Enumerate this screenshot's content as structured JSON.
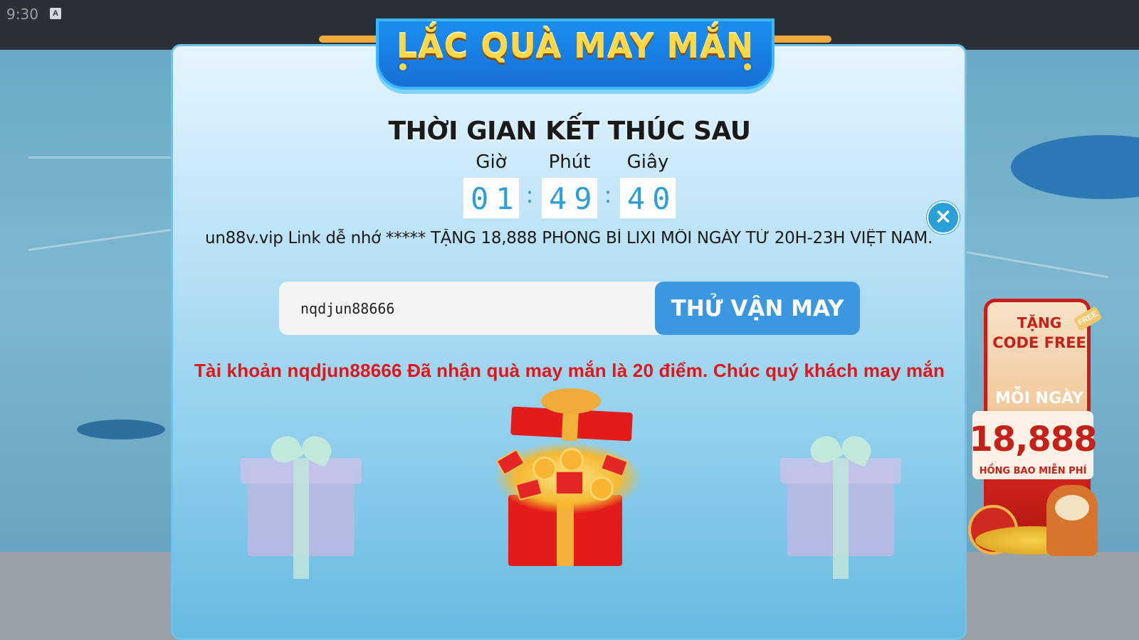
{
  "status_bar": {
    "time": "9:30",
    "sim_label": "A"
  },
  "promo_banner": {
    "line1": "TẶNG",
    "line2": "CODE FREE",
    "line3": "MỖI NGÀY",
    "amount": "18,888",
    "subtitle": "HỒNG BAO MIỄN PHÍ",
    "badge": "FREE"
  },
  "modal": {
    "header_title": "LẮC QUÀ MAY MẮN",
    "countdown_title": "THỜI GIAN KẾT THÚC SAU",
    "countdown": {
      "hours_label": "Giờ",
      "minutes_label": "Phút",
      "seconds_label": "Giây",
      "hours": "01",
      "minutes": "49",
      "seconds": "40",
      "separator": ":"
    },
    "close_icon": "×",
    "marquee": "un88v.vip Link dễ nhớ ***** TẶNG 18,888 PHONG BÌ LIXI MỖI NGÀY TỪ 20H-23H VIỆT NAM.",
    "username_input": {
      "value": "nqdjun88666",
      "placeholder": ""
    },
    "try_button": "THỬ VẬN MAY",
    "result_message": "Tài khoản nqdjun88666 Đã nhận quà may mắn là 20 điểm. Chúc quý khách may mắn",
    "gifts": [
      {
        "icon": "gift-box-icon",
        "state": "closed"
      },
      {
        "icon": "gift-box-open-icon",
        "state": "opened"
      },
      {
        "icon": "gift-box-icon",
        "state": "closed"
      }
    ]
  },
  "colors": {
    "accent": "#3b97e0",
    "result_text": "#e0161a",
    "digit": "#2d9fd6",
    "close_button": "#2a9fd8",
    "status_bar": "#2b2f38"
  }
}
